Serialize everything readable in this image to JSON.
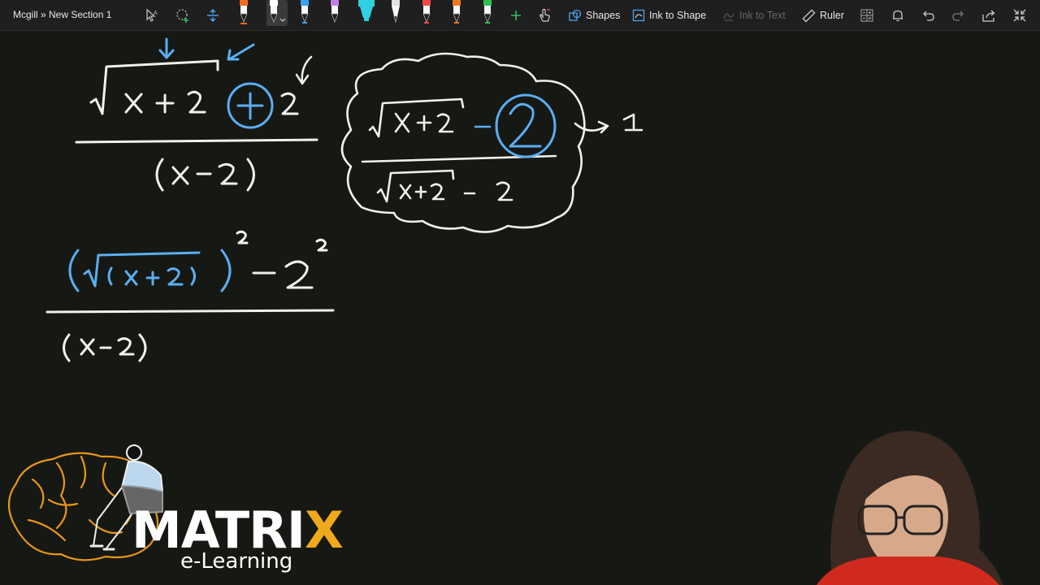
{
  "toolbar": {
    "breadcrumb": "Mcgill » New Section 1",
    "shapes_label": "Shapes",
    "ink_to_shape_label": "Ink to Shape",
    "ink_to_text_label": "Ink to Text",
    "ruler_label": "Ruler",
    "pen_colors": [
      "#f26b1d",
      "#ffffff",
      "#3aa0f0",
      "#c080e0",
      "#30d0e0",
      "#e0e0e0",
      "#f04848",
      "#f07820",
      "#30c050"
    ],
    "add_pen_color": "#2fbf5f"
  },
  "handwriting": {
    "eq1_sup": "2",
    "right_result": "1",
    "eq2_sup_a": "2",
    "eq2_sup_b": "2"
  },
  "logo": {
    "name_main": "MATRI",
    "name_x": "X",
    "tagline": "e-Learning",
    "brain_color": "#e8961a"
  }
}
